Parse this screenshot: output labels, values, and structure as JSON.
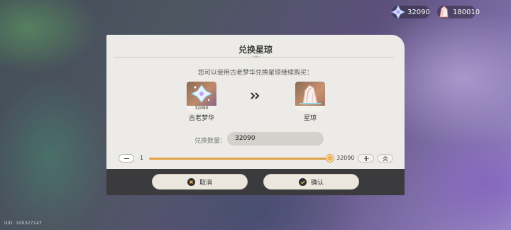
{
  "currency": {
    "stellar_jade": "32090",
    "crystal": "180010"
  },
  "uid_text": "UID: 100327147",
  "dialog": {
    "title": "兑换星琼",
    "hint": "您可以使用古老梦华兑换星琼继续购买：",
    "from_item": {
      "name": "古老梦华",
      "count": "32090",
      "icon": "ancient-dream-icon"
    },
    "to_item": {
      "name": "星琼",
      "count": "",
      "icon": "stellar-jade-icon"
    },
    "quantity_label": "兑换数量：",
    "quantity_value": "32090",
    "slider": {
      "min": "1",
      "max": "32090",
      "level": 1.0
    },
    "cancel_label": "取消",
    "confirm_label": "确认"
  },
  "colors": {
    "accent": "#e0a24a",
    "panel": "#ecebe7",
    "footer": "#3b3a3c"
  }
}
